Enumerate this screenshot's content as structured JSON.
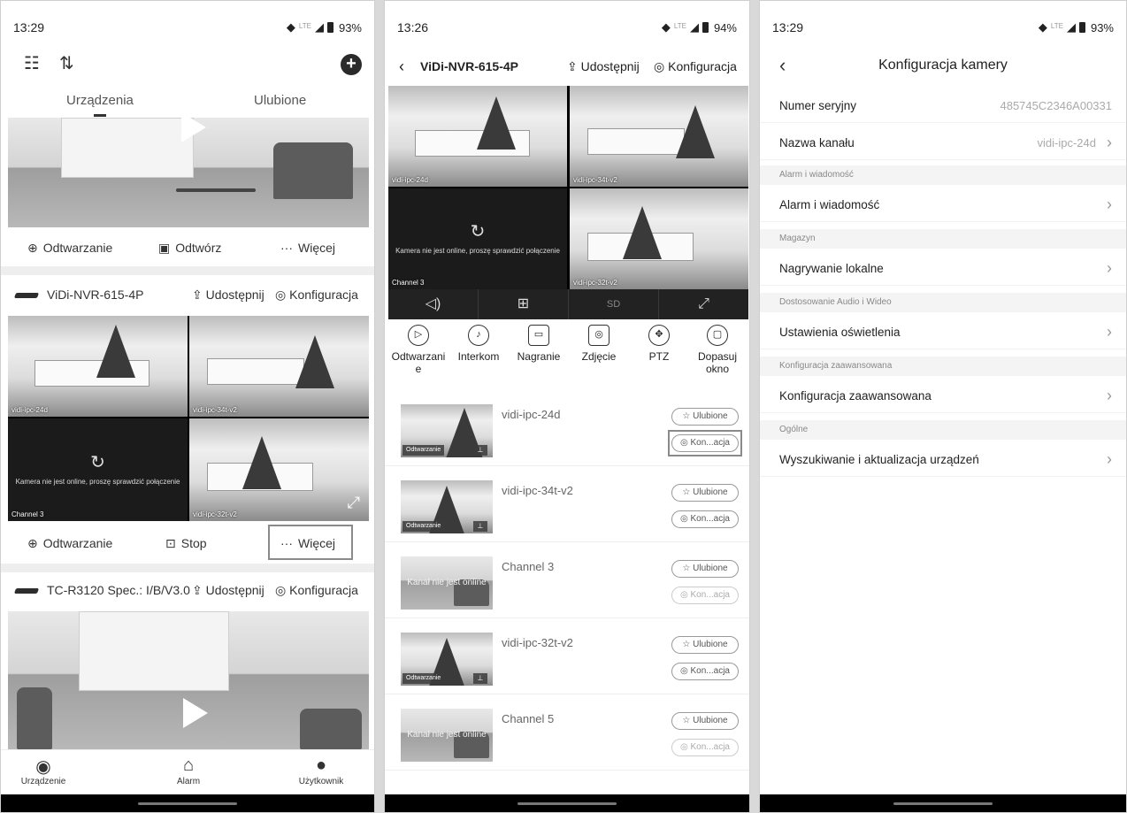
{
  "panel1": {
    "status": {
      "time": "13:29",
      "battery": "93%",
      "network": "LTE"
    },
    "tabs": [
      "Urządzenia",
      "Ulubione"
    ],
    "top_card_actions": {
      "playback": "Odtwarzanie",
      "play": "Odtwórz",
      "more": "Więcej"
    },
    "device1": {
      "name": "ViDi-NVR-615-4P",
      "share": "Udostępnij",
      "config": "Konfiguracja",
      "tiles": [
        "vidi-ipc-24d",
        "vidi-ipc-34t-v2",
        "Channel 3",
        "vidi-ipc-32t-v2"
      ],
      "offline_msg": "Kamera nie jest online, proszę sprawdzić połączenie",
      "actions": {
        "playback": "Odtwarzanie",
        "stop": "Stop",
        "more": "Więcej"
      }
    },
    "device2": {
      "name": "TC-R3120 Spec.: I/B/V3.0",
      "share": "Udostępnij",
      "config": "Konfiguracja"
    },
    "bottom_tabs": [
      "Urządzenie",
      "Alarm",
      "Użytkownik"
    ]
  },
  "panel2": {
    "status": {
      "time": "13:26",
      "battery": "94%",
      "network": "LTE"
    },
    "title": "ViDi-NVR-615-4P",
    "share": "Udostępnij",
    "config": "Konfiguracja",
    "tiles": [
      "vidi-ipc-24d",
      "vidi-ipc-34t-v2",
      "Channel 3",
      "vidi-ipc-32t-v2"
    ],
    "offline_msg": "Kamera nie jest online, proszę sprawdzić połączenie",
    "quality": "SD",
    "functions": [
      {
        "label": "Odtwarzani\ne",
        "icon": "playback-icon"
      },
      {
        "label": "Interkom",
        "icon": "microphone-icon"
      },
      {
        "label": "Nagranie",
        "icon": "record-icon"
      },
      {
        "label": "Zdjęcie",
        "icon": "camera-icon"
      },
      {
        "label": "PTZ",
        "icon": "ptz-icon"
      },
      {
        "label": "Dopasuj\nokno",
        "icon": "fit-window-icon"
      }
    ],
    "channels": [
      {
        "name": "vidi-ipc-24d",
        "online": true,
        "chip": "Odtwarzanie"
      },
      {
        "name": "vidi-ipc-34t-v2",
        "online": true,
        "chip": "Odtwarzanie"
      },
      {
        "name": "Channel 3",
        "online": false,
        "offline": "Kanał nie jest online"
      },
      {
        "name": "vidi-ipc-32t-v2",
        "online": true,
        "chip": "Odtwarzanie"
      },
      {
        "name": "Channel 5",
        "online": false,
        "offline": "Kanał nie jest online"
      }
    ],
    "fav_label": "Ulubione",
    "conf_label": "Kon...acja"
  },
  "panel3": {
    "status": {
      "time": "13:29",
      "battery": "93%",
      "network": "LTE"
    },
    "title": "Konfiguracja kamery",
    "serial_label": "Numer seryjny",
    "serial_value": "485745C2346A00331",
    "channel_name_label": "Nazwa kanału",
    "channel_name_value": "vidi-ipc-24d",
    "sections": {
      "alarm": "Alarm i wiadomość",
      "storage": "Magazyn",
      "av": "Dostosowanie Audio i Wideo",
      "advanced": "Konfiguracja zaawansowana",
      "general": "Ogólne"
    },
    "rows": {
      "alarm": "Alarm i wiadomość",
      "local_rec": "Nagrywanie lokalne",
      "lighting": "Ustawienia oświetlenia",
      "advanced": "Konfiguracja zaawansowana",
      "update": "Wyszukiwanie i aktualizacja urządzeń"
    }
  }
}
